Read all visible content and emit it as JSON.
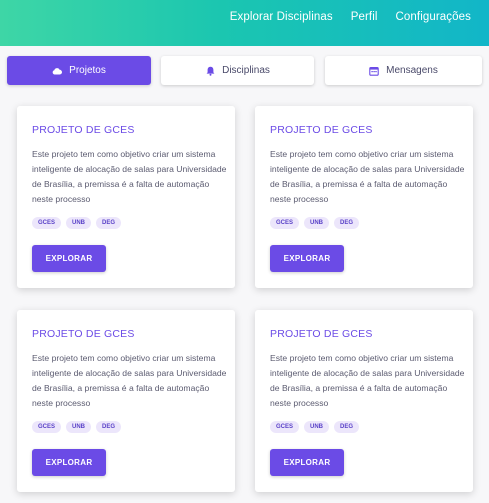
{
  "header": {
    "nav": [
      {
        "label": "Explorar Disciplinas"
      },
      {
        "label": "Perfil"
      },
      {
        "label": "Configurações"
      }
    ]
  },
  "tabs": [
    {
      "label": "Projetos",
      "icon": "cloud-icon",
      "active": true
    },
    {
      "label": "Disciplinas",
      "icon": "bell-icon",
      "active": false
    },
    {
      "label": "Mensagens",
      "icon": "calendar-icon",
      "active": false
    }
  ],
  "cards": [
    {
      "title": "PROJETO DE GCES",
      "description": "Este projeto tem como objetivo criar um sistema inteligente de alocação de salas para Universidade de Brasília, a premissa é a falta de automação neste processo",
      "tags": [
        "GCES",
        "UNB",
        "DEG"
      ],
      "button": "EXPLORAR"
    },
    {
      "title": "PROJETO DE GCES",
      "description": "Este projeto tem como objetivo criar um sistema inteligente de alocação de salas para Universidade de Brasília, a premissa é a falta de automação neste processo",
      "tags": [
        "GCES",
        "UNB",
        "DEG"
      ],
      "button": "EXPLORAR"
    },
    {
      "title": "PROJETO DE GCES",
      "description": "Este projeto tem como objetivo criar um sistema inteligente de alocação de salas para Universidade de Brasília, a premissa é a falta de automação neste processo",
      "tags": [
        "GCES",
        "UNB",
        "DEG"
      ],
      "button": "EXPLORAR"
    },
    {
      "title": "PROJETO DE GCES",
      "description": "Este projeto tem como objetivo criar um sistema inteligente de alocação de salas para Universidade de Brasília, a premissa é a falta de automação neste processo",
      "tags": [
        "GCES",
        "UNB",
        "DEG"
      ],
      "button": "EXPLORAR"
    }
  ],
  "colors": {
    "accent": "#6b4be6",
    "header_gradient_start": "#3ed6a6",
    "header_gradient_end": "#12b6c8",
    "tag_background": "#ece6fb"
  }
}
